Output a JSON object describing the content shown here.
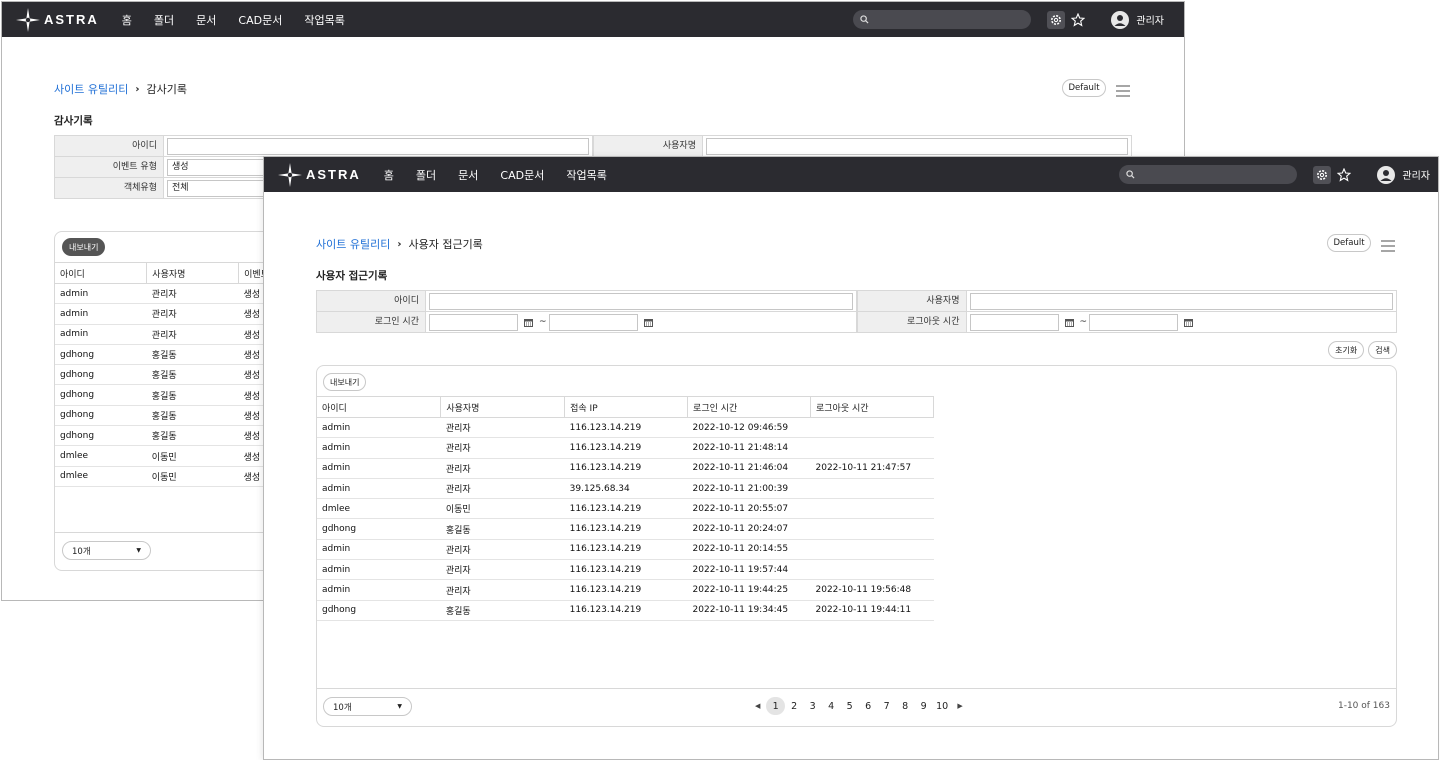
{
  "brand": "ASTRA",
  "nav": [
    "홈",
    "폴더",
    "문서",
    "CAD문서",
    "작업목록"
  ],
  "user_name": "관리자",
  "default_label": "Default",
  "export_label": "내보내기",
  "page_size": "10개",
  "back": {
    "breadcrumb_link": "사이트 유틸리티",
    "breadcrumb_current": "감사기록",
    "section_title": "감사기록",
    "filters": {
      "id_label": "아이디",
      "user_label": "사용자명",
      "event_label": "이벤트 유형",
      "event_value": "생성",
      "object_label": "객체유형",
      "object_value": "전체"
    },
    "columns": [
      "아이디",
      "사용자명",
      "이벤트"
    ],
    "rows": [
      [
        "admin",
        "관리자",
        "생성"
      ],
      [
        "admin",
        "관리자",
        "생성"
      ],
      [
        "admin",
        "관리자",
        "생성"
      ],
      [
        "gdhong",
        "홍길동",
        "생성"
      ],
      [
        "gdhong",
        "홍길동",
        "생성"
      ],
      [
        "gdhong",
        "홍길동",
        "생성"
      ],
      [
        "gdhong",
        "홍길동",
        "생성"
      ],
      [
        "gdhong",
        "홍길동",
        "생성"
      ],
      [
        "dmlee",
        "이동민",
        "생성"
      ],
      [
        "dmlee",
        "이동민",
        "생성"
      ]
    ]
  },
  "front": {
    "breadcrumb_link": "사이트 유틸리티",
    "breadcrumb_current": "사용자 접근기록",
    "section_title": "사용자 접근기록",
    "filters": {
      "id_label": "아이디",
      "user_label": "사용자명",
      "login_label": "로그인 시간",
      "logout_label": "로그아웃 시간",
      "tilde": "~"
    },
    "reset_label": "초기화",
    "search_label": "검색",
    "columns": [
      "아이디",
      "사용자명",
      "접속 IP",
      "로그인 시간",
      "로그아웃 시간"
    ],
    "rows": [
      [
        "admin",
        "관리자",
        "116.123.14.219",
        "2022-10-12 09:46:59",
        ""
      ],
      [
        "admin",
        "관리자",
        "116.123.14.219",
        "2022-10-11 21:48:14",
        ""
      ],
      [
        "admin",
        "관리자",
        "116.123.14.219",
        "2022-10-11 21:46:04",
        "2022-10-11 21:47:57"
      ],
      [
        "admin",
        "관리자",
        "39.125.68.34",
        "2022-10-11 21:00:39",
        ""
      ],
      [
        "dmlee",
        "이동민",
        "116.123.14.219",
        "2022-10-11 20:55:07",
        ""
      ],
      [
        "gdhong",
        "홍길동",
        "116.123.14.219",
        "2022-10-11 20:24:07",
        ""
      ],
      [
        "admin",
        "관리자",
        "116.123.14.219",
        "2022-10-11 20:14:55",
        ""
      ],
      [
        "admin",
        "관리자",
        "116.123.14.219",
        "2022-10-11 19:57:44",
        ""
      ],
      [
        "admin",
        "관리자",
        "116.123.14.219",
        "2022-10-11 19:44:25",
        "2022-10-11 19:56:48"
      ],
      [
        "gdhong",
        "홍길동",
        "116.123.14.219",
        "2022-10-11 19:34:45",
        "2022-10-11 19:44:11"
      ]
    ],
    "pages": [
      "1",
      "2",
      "3",
      "4",
      "5",
      "6",
      "7",
      "8",
      "9",
      "10"
    ],
    "active_page": "1",
    "total": "1-10 of 163"
  }
}
